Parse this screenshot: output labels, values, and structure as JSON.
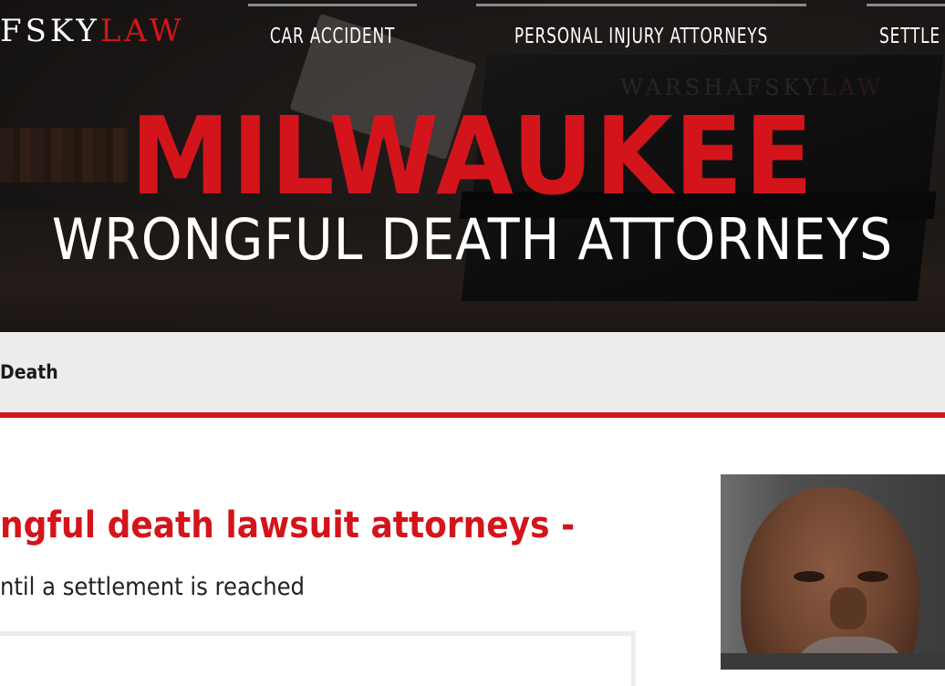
{
  "header": {
    "logo_text": "FSKY",
    "logo_accent": "LAW",
    "nav": [
      {
        "label": "CAR ACCIDENT"
      },
      {
        "label": "PERSONAL INJURY ATTORNEYS"
      },
      {
        "label": "SETTLE"
      }
    ]
  },
  "hero": {
    "watermark_text": "WARSHAFSKY",
    "watermark_accent": "LAW",
    "city": "MILWAUKEE",
    "subtitle": "WRONGFUL DEATH ATTORNEYS"
  },
  "breadcrumb": {
    "current": "Death"
  },
  "main": {
    "heading": "ngful death lawsuit attorneys -",
    "body": "ntil a settlement is reached"
  },
  "colors": {
    "brand_red": "#d3141b",
    "breadcrumb_bg": "#ecedea",
    "nav_text": "#ffffff"
  }
}
